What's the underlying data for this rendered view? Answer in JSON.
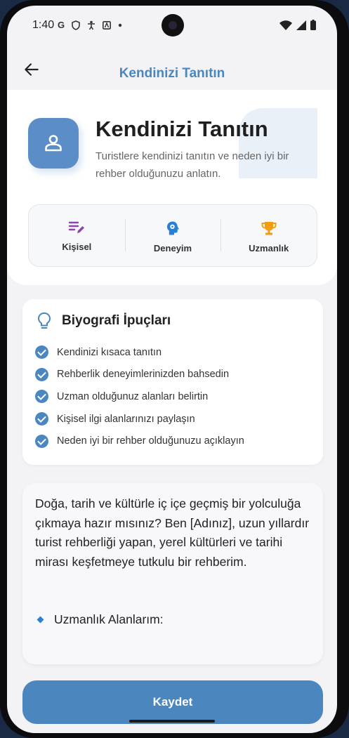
{
  "status_bar": {
    "time": "1:40",
    "left_icons": [
      "google-icon",
      "shield-icon",
      "accessibility-icon",
      "font-icon",
      "dot-icon"
    ],
    "right_icons": [
      "wifi-icon",
      "signal-icon",
      "battery-icon"
    ]
  },
  "app_bar": {
    "title": "Kendinizi Tanıtın",
    "back_icon": "arrow-left-icon"
  },
  "header": {
    "title": "Kendinizi Tanıtın",
    "subtitle": "Turistlere kendinizi tanıtın ve neden iyi bir rehber olduğunuzu anlatın.",
    "avatar_icon": "person-icon",
    "tabs": [
      {
        "label": "Kişisel",
        "icon": "edit-note-icon",
        "color": "#8e44ad"
      },
      {
        "label": "Deneyim",
        "icon": "psychology-icon",
        "color": "#2a7fd4"
      },
      {
        "label": "Uzmanlık",
        "icon": "trophy-icon",
        "color": "#f39c12"
      }
    ]
  },
  "tips": {
    "title": "Biyografi İpuçları",
    "icon": "lightbulb-icon",
    "items": [
      "Kendinizi kısaca tanıtın",
      "Rehberlik deneyimlerinizden bahsedin",
      "Uzman olduğunuz alanları belirtin",
      "Kişisel ilgi alanlarınızı paylaşın",
      "Neden iyi bir rehber olduğunuzu açıklayın"
    ]
  },
  "bio": {
    "text": "Doğa, tarih ve kültürle iç içe geçmiş bir yolculuğa çıkmaya hazır mısınız? Ben [Adınız], uzun yıllardır turist rehberliği yapan, yerel kültürleri ve tarihi mirası keşfetmeye tutkulu bir rehberim.",
    "section_label": "Uzmanlık Alanlarım:",
    "section_icon": "blue-diamond-icon"
  },
  "save_label": "Kaydet",
  "colors": {
    "primary": "#4b86bf",
    "title_accent": "#4a86bf",
    "background": "#f3f3f5"
  }
}
